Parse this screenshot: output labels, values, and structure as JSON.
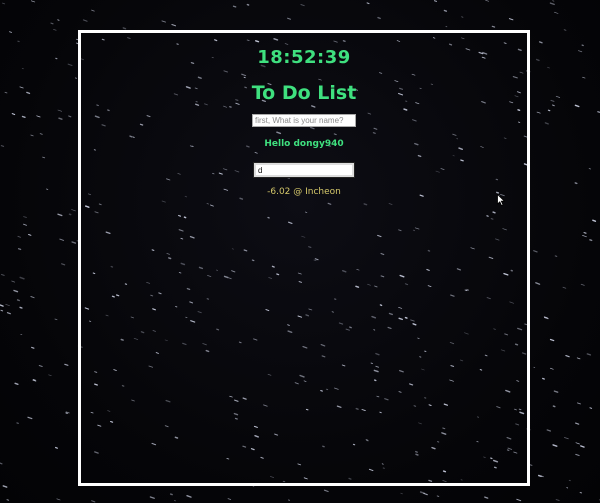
{
  "clock": {
    "time": "18:52:39"
  },
  "app": {
    "title": "To Do List"
  },
  "name_form": {
    "placeholder": "first, What is your name?",
    "value": ""
  },
  "greeting": {
    "text": "Hello dongy940"
  },
  "todo_form": {
    "value": "d"
  },
  "weather": {
    "text": "-6.02 @ Incheon"
  },
  "colors": {
    "accent": "#3fe07f",
    "weather": "#d4c76a",
    "frame": "#ffffff",
    "background": "#06060a"
  },
  "icons": {
    "pointer": "mouse-cursor-icon"
  }
}
